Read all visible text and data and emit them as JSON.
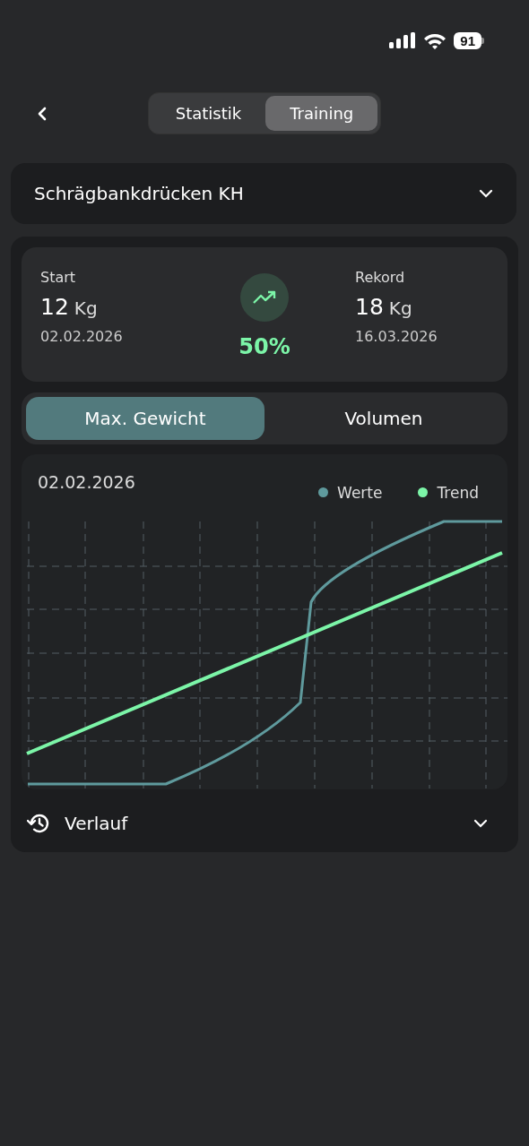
{
  "status_bar": {
    "battery": "91"
  },
  "header": {
    "tabs": [
      {
        "label": "Statistik",
        "selected": false
      },
      {
        "label": "Training",
        "selected": true
      }
    ]
  },
  "exercise_select": {
    "value": "Schrägbankdrücken KH"
  },
  "summary": {
    "start": {
      "label": "Start",
      "value": "12",
      "unit": "Kg",
      "date": "02.02.2026"
    },
    "change": "50%",
    "record": {
      "label": "Rekord",
      "value": "18",
      "unit": "Kg",
      "date": "16.03.2026"
    }
  },
  "metric_tabs": [
    {
      "label": "Max. Gewicht",
      "selected": true
    },
    {
      "label": "Volumen",
      "selected": false
    }
  ],
  "chart": {
    "date": "02.02.2026",
    "legend": [
      {
        "label": "Werte",
        "color": "#5f9a9d"
      },
      {
        "label": "Trend",
        "color": "#7cf5a8"
      }
    ]
  },
  "history": {
    "label": "Verlauf",
    "expanded": false
  }
}
